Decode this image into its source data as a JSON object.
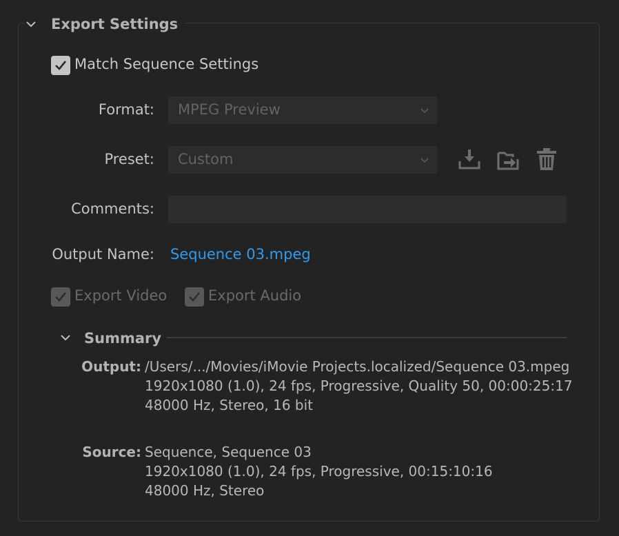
{
  "export_settings": {
    "title": "Export Settings",
    "match_sequence": {
      "label": "Match Sequence Settings",
      "checked": true
    },
    "format": {
      "label": "Format:",
      "value": "MPEG Preview"
    },
    "preset": {
      "label": "Preset:",
      "value": "Custom"
    },
    "preset_actions": {
      "save_icon": "download-save-icon",
      "import_icon": "import-folder-icon",
      "delete_icon": "trash-icon"
    },
    "comments": {
      "label": "Comments:",
      "value": ""
    },
    "output_name": {
      "label": "Output Name:",
      "value": "Sequence 03.mpeg"
    },
    "export_video": {
      "label": "Export Video",
      "checked": true,
      "enabled": false
    },
    "export_audio": {
      "label": "Export Audio",
      "checked": true,
      "enabled": false
    }
  },
  "summary": {
    "title": "Summary",
    "output": {
      "key": "Output:",
      "lines": [
        "/Users/.../Movies/iMovie Projects.localized/Sequence 03.mpeg",
        "1920x1080 (1.0), 24 fps, Progressive, Quality 50, 00:00:25:17",
        "48000 Hz, Stereo, 16 bit"
      ]
    },
    "source": {
      "key": "Source:",
      "lines": [
        "Sequence, Sequence 03",
        "1920x1080 (1.0), 24 fps, Progressive, 00:15:10:16",
        "48000 Hz, Stereo"
      ]
    }
  },
  "colors": {
    "background": "#232323",
    "link": "#2f9bf0",
    "field": "#2c2c2c"
  }
}
